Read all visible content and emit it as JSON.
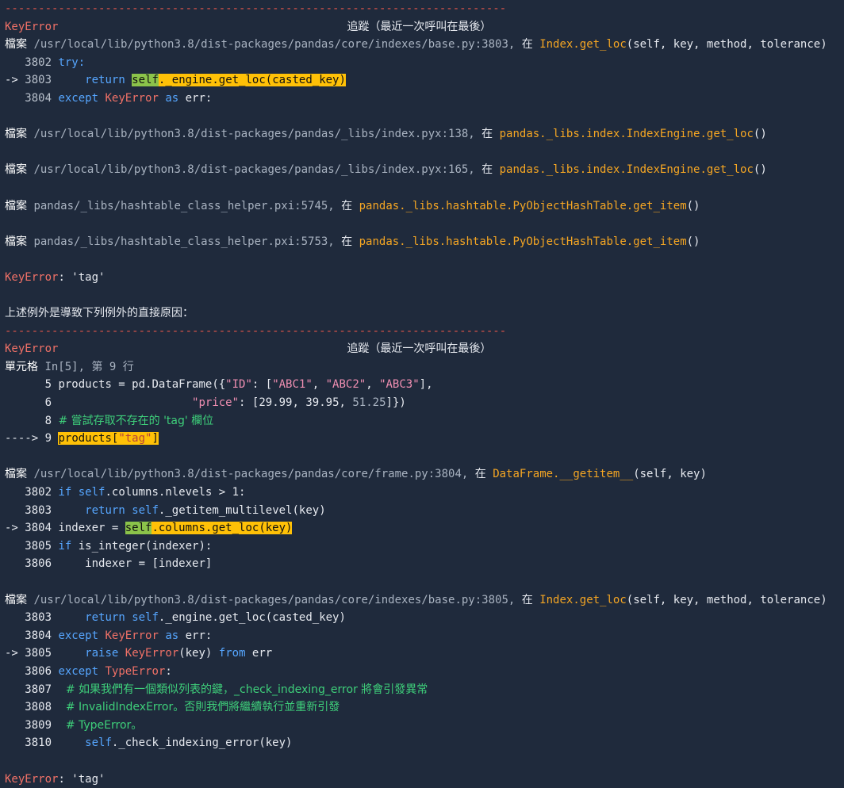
{
  "traceback": {
    "separator": "---------------------------------------------------------------------------",
    "error_name": "KeyError",
    "title": "追蹤（最近一次呼叫在最後）",
    "file_label": "檔案",
    "cell_label": "單元格",
    "in_word": "在",
    "err_message": "KeyError: 'tag'",
    "direct_cause": "上述例外是導致下列例外的直接原因："
  },
  "lines1": [
    {
      "type": "sep"
    },
    {
      "type": "title"
    },
    {
      "type": "file",
      "path": "/usr/local/lib/python3.8/dist-packages/pandas/core/indexes/base.py:3803,",
      "func": "Index.get_loc",
      "args": "(self, key, method, tolerance)"
    },
    {
      "type": "code",
      "num": "3802",
      "arrow": "",
      "code": "try:"
    },
    {
      "type": "code",
      "num": "3803",
      "arrow": "->",
      "code": "    return self._engine.get_loc(casted_key)"
    },
    {
      "type": "code",
      "num": "3804",
      "arrow": "",
      "code": "except KeyError as err:"
    },
    {
      "type": "blank"
    },
    {
      "type": "file",
      "path": "/usr/local/lib/python3.8/dist-packages/pandas/_libs/index.pyx:138,",
      "func": "pandas._libs.index.IndexEngine.get_loc",
      "args": "()"
    },
    {
      "type": "blank"
    },
    {
      "type": "file",
      "path": "/usr/local/lib/python3.8/dist-packages/pandas/_libs/index.pyx:165,",
      "func": "pandas._libs.index.IndexEngine.get_loc",
      "args": "()"
    },
    {
      "type": "blank"
    },
    {
      "type": "file",
      "path": "pandas/_libs/hashtable_class_helper.pxi:5745,",
      "func": "pandas._libs.hashtable.PyObjectHashTable.get_item",
      "args": "()"
    },
    {
      "type": "blank"
    },
    {
      "type": "file",
      "path": "pandas/_libs/hashtable_class_helper.pxi:5753,",
      "func": "pandas._libs.hashtable.PyObjectHashTable.get_item",
      "args": "()"
    },
    {
      "type": "blank"
    },
    {
      "type": "errmsg"
    },
    {
      "type": "blank"
    },
    {
      "type": "cause"
    },
    {
      "type": "sep"
    },
    {
      "type": "title"
    },
    {
      "type": "cell",
      "ref": "In[5], 第 9 行"
    },
    {
      "type": "code5"
    },
    {
      "type": "code6"
    },
    {
      "type": "code7"
    },
    {
      "type": "code8"
    },
    {
      "type": "blank"
    },
    {
      "type": "file",
      "path": "/usr/local/lib/python3.8/dist-packages/pandas/core/frame.py:3804,",
      "func": "DataFrame.__getitem__",
      "args": "(self, key)"
    },
    {
      "type": "f1"
    },
    {
      "type": "f2"
    },
    {
      "type": "f3"
    },
    {
      "type": "f4"
    },
    {
      "type": "f5"
    },
    {
      "type": "blank"
    },
    {
      "type": "file",
      "path": "/usr/local/lib/python3.8/dist-packages/pandas/core/indexes/base.py:3805,",
      "func": "Index.get_loc",
      "args": "(self, key, method, tolerance)"
    },
    {
      "type": "g1"
    },
    {
      "type": "g2"
    },
    {
      "type": "g3"
    },
    {
      "type": "g4"
    },
    {
      "type": "g5"
    },
    {
      "type": "g6"
    },
    {
      "type": "g7"
    },
    {
      "type": "g8"
    },
    {
      "type": "blank"
    },
    {
      "type": "errmsg"
    }
  ],
  "code": {
    "c5": {
      "num": "5",
      "pre": "products = pd.DataFrame({",
      "s1": "\"ID\"",
      "m1": ": [",
      "s2": "\"ABC1\"",
      "s3": "\"ABC2\"",
      "s4": "\"ABC3\"",
      "end": "],"
    },
    "c6": {
      "num": "6",
      "indent": "                    ",
      "s1": "\"price\"",
      "m1": ": [",
      "n1": "29.99",
      "n2": "39.95",
      "n3": "51.25",
      "end": "]})"
    },
    "c7": {
      "num": "8",
      "comment": "# 嘗試存取不存在的 'tag' 欄位"
    },
    "c8": {
      "num": "9",
      "arrow": "---->",
      "pre": "products[",
      "s1": "\"tag\"",
      "end": "]"
    },
    "f1": {
      "num": "3802",
      "text": "if self.columns.nlevels > 1:"
    },
    "f2": {
      "num": "3803",
      "text": "    return self._getitem_multilevel(key)"
    },
    "f3": {
      "num": "3804",
      "text": "indexer = self.columns.get_loc(key)"
    },
    "f4": {
      "num": "3805",
      "text": "if is_integer(indexer):"
    },
    "f5": {
      "num": "3806",
      "text": "    indexer = [indexer]"
    },
    "g1": {
      "num": "3803",
      "text": "    return self._engine.get_loc(casted_key)"
    },
    "g2": {
      "num": "3804",
      "text": "except KeyError as err:"
    },
    "g3": {
      "num": "3805",
      "text": "    raise KeyError(key) from err"
    },
    "g4": {
      "num": "3806",
      "text": "except TypeError:"
    },
    "g5": {
      "num": "3807",
      "text": "    # 如果我們有一個類似列表的鍵，_check_indexing_error 將會引發異常"
    },
    "g6": {
      "num": "3808",
      "text": "    # InvalidIndexError。否則我們將繼續執行並重新引發"
    },
    "g7": {
      "num": "3809",
      "text": "    # TypeError。"
    },
    "g8": {
      "num": "3810",
      "text": "    self._check_indexing_error(key)"
    }
  }
}
